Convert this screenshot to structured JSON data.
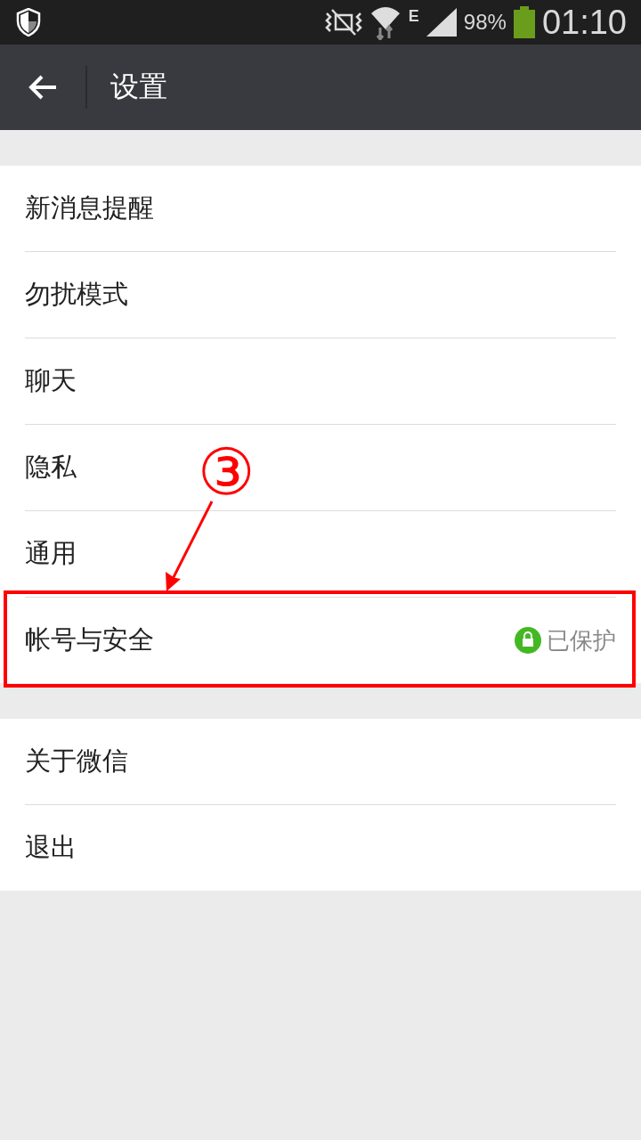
{
  "status_bar": {
    "network": "E",
    "battery": "98%",
    "time": "01:10"
  },
  "toolbar": {
    "title": "设置"
  },
  "groups": [
    {
      "items": [
        {
          "label": "新消息提醒"
        },
        {
          "label": "勿扰模式"
        },
        {
          "label": "聊天"
        },
        {
          "label": "隐私"
        },
        {
          "label": "通用"
        },
        {
          "label": "帐号与安全",
          "status": "已保护"
        }
      ]
    },
    {
      "items": [
        {
          "label": "关于微信"
        },
        {
          "label": "退出"
        }
      ]
    }
  ],
  "annotation": {
    "marker": "③"
  }
}
